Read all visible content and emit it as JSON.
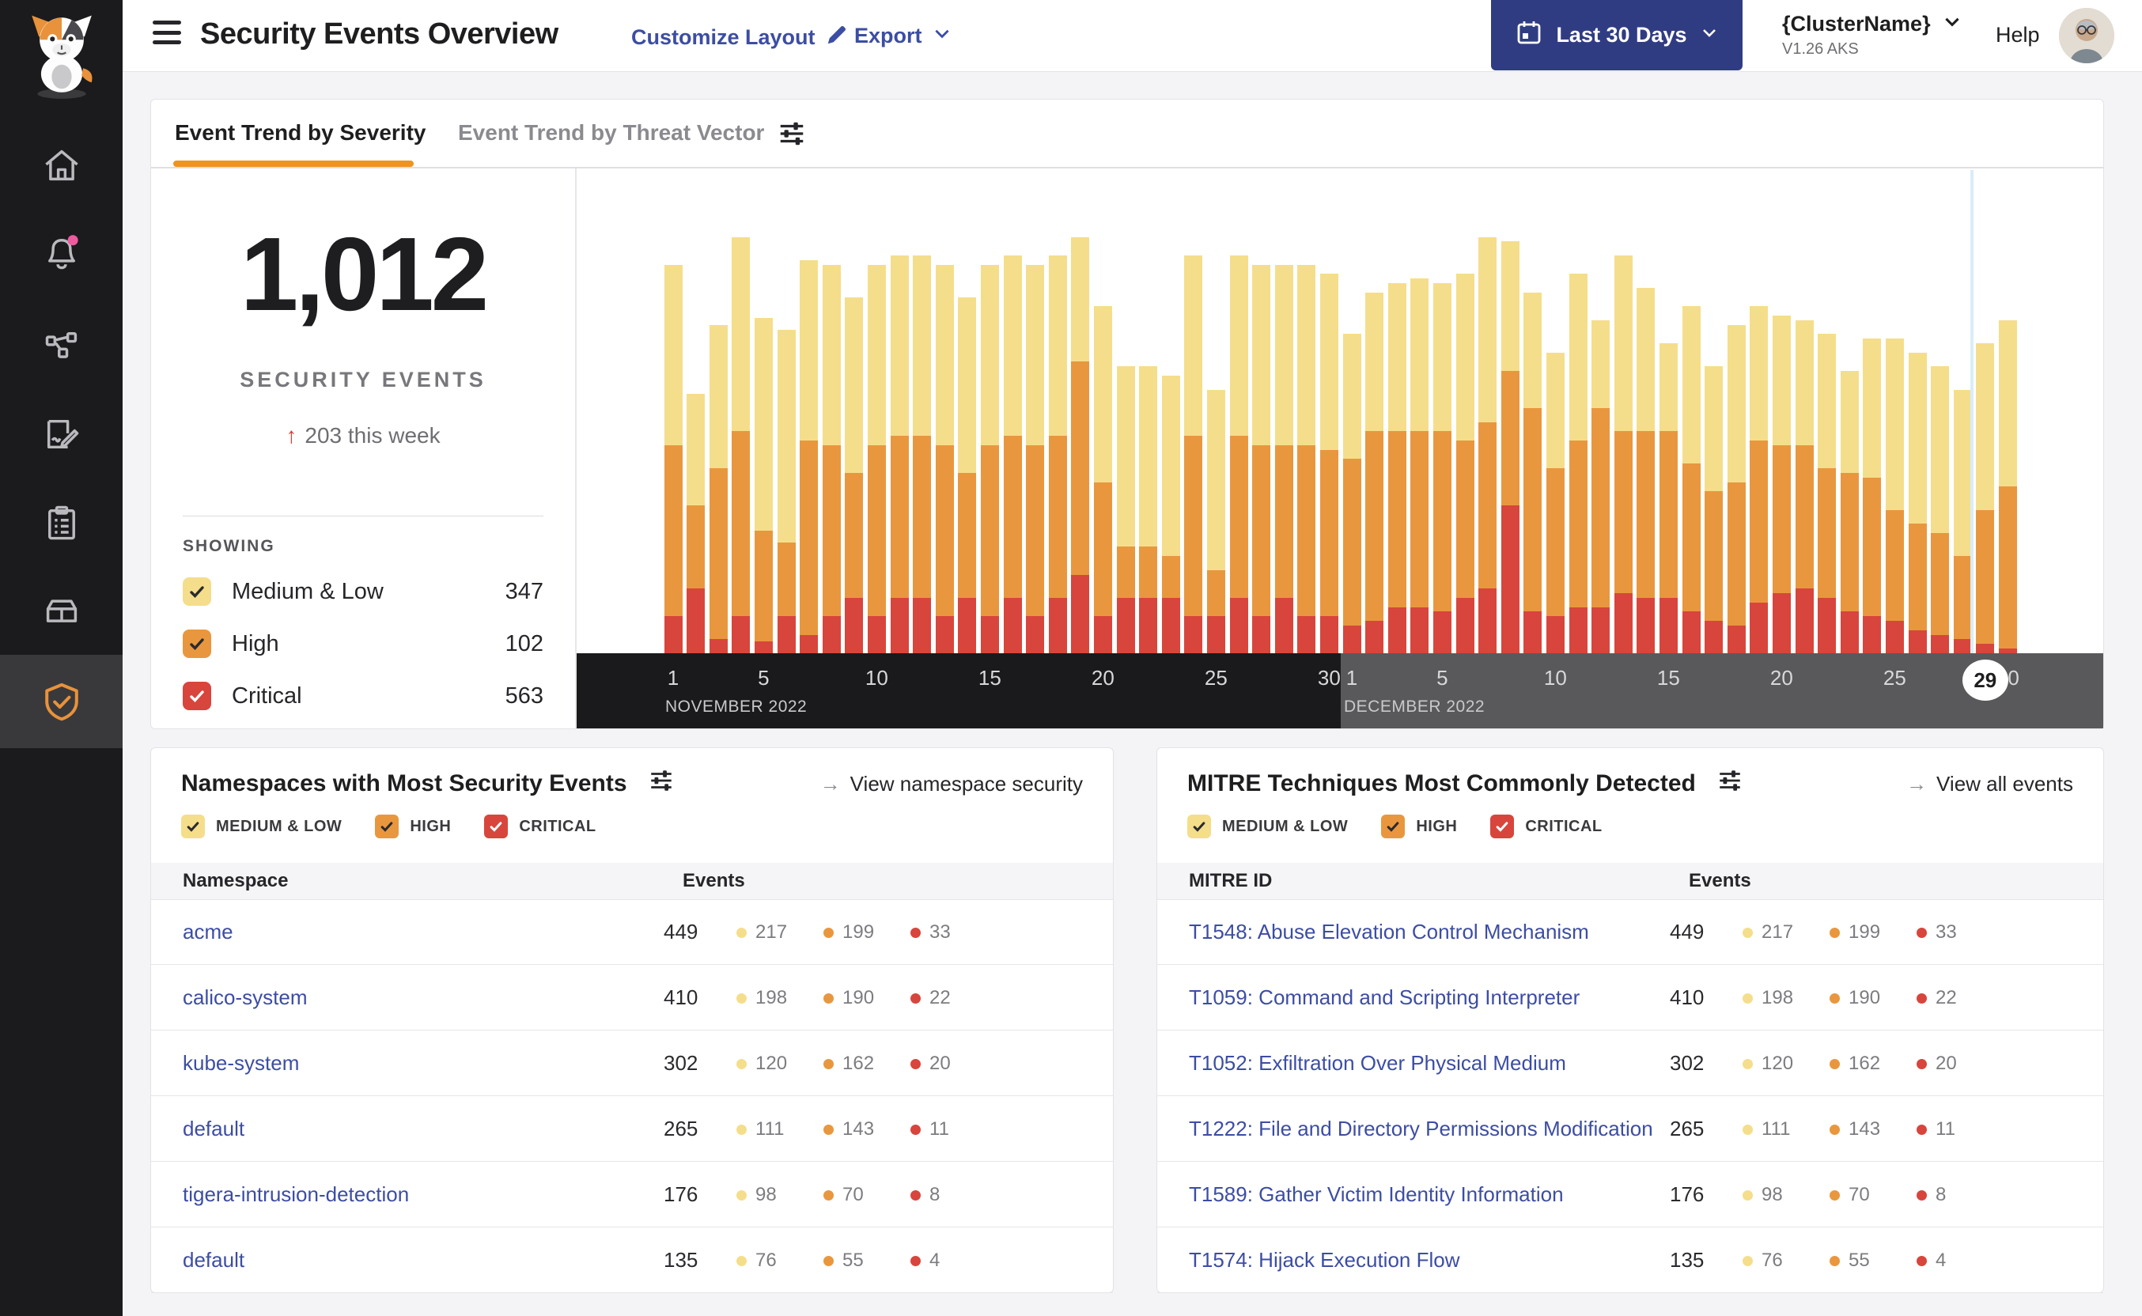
{
  "header": {
    "title": "Security Events Overview",
    "customize_label": "Customize Layout",
    "export_label": "Export",
    "date_range_label": "Last 30 Days",
    "cluster_name": "{ClusterName}",
    "cluster_version": "V1.26 AKS",
    "help_label": "Help"
  },
  "tabs": [
    {
      "label": "Event Trend by Severity",
      "active": true
    },
    {
      "label": "Event Trend by Threat Vector",
      "active": false
    }
  ],
  "summary": {
    "total": "1,012",
    "label": "SECURITY EVENTS",
    "delta_arrow": "↑",
    "delta_text": "203 this week",
    "showing_label": "SHOWING"
  },
  "severities": [
    {
      "label": "Medium & Low",
      "upper": "MEDIUM & LOW",
      "count": 347,
      "color": "#F5DE8B",
      "check": "#2A2A2E"
    },
    {
      "label": "High",
      "upper": "HIGH",
      "count": 102,
      "color": "#E9973E",
      "check": "#2A2A2E"
    },
    {
      "label": "Critical",
      "upper": "CRITICAL",
      "count": 563,
      "color": "#D8453C",
      "check": "#FFFFFF"
    }
  ],
  "chart_data": {
    "type": "bar",
    "stacked": true,
    "title": "Event Trend by Severity",
    "x_months": [
      {
        "label": "NOVEMBER 2022",
        "days": 30
      },
      {
        "label": "DECEMBER 2022",
        "days": 30
      }
    ],
    "tick_days": [
      1,
      5,
      10,
      15,
      20,
      25,
      30
    ],
    "y_unit": "percent",
    "ylim": [
      0,
      100
    ],
    "grid": false,
    "legend_position": "left-panel",
    "highlight": {
      "month_index": 1,
      "day": 29,
      "label": "29"
    },
    "series": [
      {
        "name": "Critical",
        "color": "#D8453C",
        "values": [
          8,
          14,
          3,
          8,
          2.5,
          8,
          4,
          8,
          12,
          8,
          12,
          12,
          8,
          12,
          8,
          12,
          8,
          12,
          17,
          8,
          12,
          12,
          12,
          8,
          8,
          12,
          8,
          12,
          8,
          8,
          6,
          7,
          10,
          10,
          9,
          12,
          14,
          32,
          9,
          8,
          10,
          10,
          13,
          12,
          12,
          9,
          7,
          6,
          11,
          13,
          14,
          12,
          9,
          8,
          7,
          5,
          4,
          3,
          2,
          1
        ]
      },
      {
        "name": "High",
        "color": "#E9973E",
        "values": [
          37,
          18,
          37,
          40,
          24,
          16,
          42,
          37,
          27,
          37,
          35,
          35,
          37,
          27,
          37,
          35,
          37,
          35,
          46,
          29,
          11,
          11,
          9,
          39,
          10,
          35,
          37,
          33,
          37,
          36,
          36,
          41,
          38,
          38,
          39,
          34,
          36,
          29,
          44,
          32,
          36,
          43,
          35,
          36,
          36,
          32,
          28,
          31,
          35,
          32,
          31,
          28,
          30,
          30,
          24,
          23,
          22,
          18,
          29,
          35
        ]
      },
      {
        "name": "Medium & Low",
        "color": "#F5DE8B",
        "values": [
          39,
          24,
          31,
          42,
          46,
          46,
          39,
          39,
          38,
          39,
          39,
          39,
          39,
          38,
          39,
          39,
          39,
          39,
          27,
          38,
          39,
          39,
          39,
          39,
          39,
          39,
          39,
          39,
          39,
          38,
          27,
          30,
          32,
          33,
          32,
          36,
          40,
          28,
          25,
          25,
          36,
          19,
          38,
          31,
          19,
          34,
          27,
          34,
          29,
          28,
          27,
          29,
          22,
          30,
          37,
          37,
          36,
          36,
          36,
          36
        ]
      }
    ]
  },
  "namespaces_panel": {
    "title": "Namespaces with Most Security Events",
    "link_label": "View namespace security",
    "link_arrow": "→",
    "columns": [
      "Namespace",
      "Events"
    ],
    "rows": [
      {
        "name": "acme",
        "total": 449,
        "values": [
          217,
          199,
          33
        ]
      },
      {
        "name": "calico-system",
        "total": 410,
        "values": [
          198,
          190,
          22
        ]
      },
      {
        "name": "kube-system",
        "total": 302,
        "values": [
          120,
          162,
          20
        ]
      },
      {
        "name": "default",
        "total": 265,
        "values": [
          111,
          143,
          11
        ]
      },
      {
        "name": "tigera-intrusion-detection",
        "total": 176,
        "values": [
          98,
          70,
          8
        ]
      },
      {
        "name": "default",
        "total": 135,
        "values": [
          76,
          55,
          4
        ]
      }
    ]
  },
  "mitre_panel": {
    "title": "MITRE Techniques Most Commonly Detected",
    "link_label": "View all events",
    "link_arrow": "→",
    "columns": [
      "MITRE ID",
      "Events"
    ],
    "rows": [
      {
        "name": "T1548: Abuse Elevation Control Mechanism",
        "total": 449,
        "values": [
          217,
          199,
          33
        ]
      },
      {
        "name": "T1059: Command and Scripting Interpreter",
        "total": 410,
        "values": [
          198,
          190,
          22
        ]
      },
      {
        "name": "T1052: Exfiltration Over Physical Medium",
        "total": 302,
        "values": [
          120,
          162,
          20
        ]
      },
      {
        "name": "T1222: File and Directory Permissions Modification",
        "total": 265,
        "values": [
          111,
          143,
          11
        ]
      },
      {
        "name": "T1589: Gather Victim Identity Information",
        "total": 176,
        "values": [
          98,
          70,
          8
        ]
      },
      {
        "name": "T1574: Hijack Execution Flow",
        "total": 135,
        "values": [
          76,
          55,
          4
        ]
      }
    ]
  },
  "colors": {
    "accent_orange": "#F0931F",
    "severity_medium_low": "#F5DE8B",
    "severity_high": "#E9973E",
    "severity_critical": "#D8453C",
    "link_indigo": "#3C4DA3",
    "button_navy": "#303C82",
    "cursor_blue": "#D9EDF7",
    "notification_pink": "#EE5A9E",
    "axis_november_bg": "#1A1A1C",
    "axis_december_bg": "#59595B"
  }
}
